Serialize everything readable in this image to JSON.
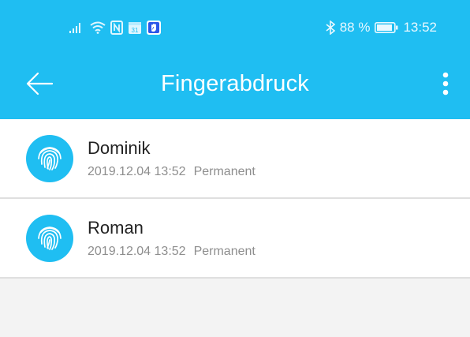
{
  "colors": {
    "accent": "#1fbef2",
    "background": "#f3f3f3",
    "row_background": "#ffffff",
    "divider": "#dfdfdf",
    "name_text": "#222222",
    "meta_text": "#8e8e8e"
  },
  "statusbar": {
    "left_icons": [
      "signal-icon",
      "wifi-icon",
      "nfc-icon",
      "calendar-icon",
      "security-app-icon"
    ],
    "calendar_day": "31",
    "bluetooth_icon": "bluetooth-icon",
    "battery_percent": "88 %",
    "battery_icon": "battery-icon",
    "time": "13:52"
  },
  "appbar": {
    "back_icon": "arrow-left-icon",
    "title": "Fingerabdruck",
    "menu_icon": "more-vert-icon"
  },
  "fingerprints": [
    {
      "icon": "fingerprint-icon",
      "name": "Dominik",
      "date": "2019.12.04 13:52",
      "duration": "Permanent"
    },
    {
      "icon": "fingerprint-icon",
      "name": "Roman",
      "date": "2019.12.04 13:52",
      "duration": "Permanent"
    }
  ]
}
